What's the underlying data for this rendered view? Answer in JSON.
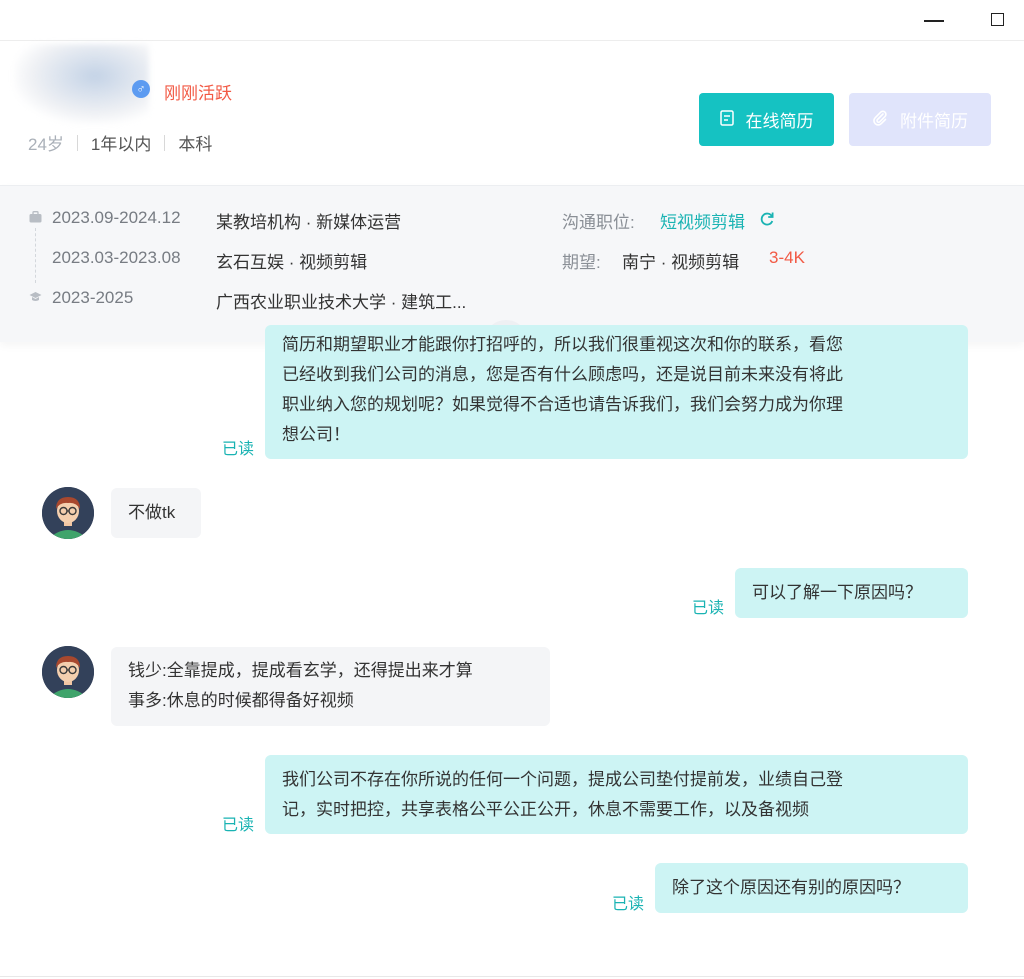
{
  "window": {
    "minimize_icon": "minimize-icon",
    "maximize_icon": "maximize-icon"
  },
  "candidate": {
    "gender_icon": "♂",
    "active_status": "刚刚活跃",
    "age": "24岁",
    "experience": "1年以内",
    "education": "本科"
  },
  "actions": {
    "online_resume": "在线简历",
    "attachment_resume": "附件简历"
  },
  "history": [
    {
      "date": "2023.09-2024.12",
      "desc": "某教培机构 · 新媒体运营",
      "icon": "briefcase-icon"
    },
    {
      "date": "2023.03-2023.08",
      "desc": "玄石互娱 · 视频剪辑",
      "icon": ""
    },
    {
      "date": "2023-2025",
      "desc": "广西农业职业技术大学 · 建筑工...",
      "icon": "graduation-cap-icon"
    }
  ],
  "job": {
    "comm_label": "沟通职位:",
    "comm_value": "短视频剪辑",
    "expect_label": "期望:",
    "expect_value": "南宁 · 视频剪辑",
    "salary": "3-4K"
  },
  "messages": [
    {
      "from": "me",
      "lines": [
        "简历和期望职业才能跟你打招呼的，所以我们很重视这次和你的联系，看您",
        "已经收到我们公司的消息，您是否有什么顾虑吗，还是说目前未来没有将此",
        "职业纳入您的规划呢？如果觉得不合适也请告诉我们，我们会努力成为你理",
        "想公司！"
      ],
      "status": "已读"
    },
    {
      "from": "them",
      "lines": [
        "不做tk"
      ]
    },
    {
      "from": "me",
      "lines": [
        "可以了解一下原因吗？"
      ],
      "status": "已读"
    },
    {
      "from": "them",
      "lines": [
        "钱少:全靠提成，提成看玄学，还得提出来才算",
        "事多:休息的时候都得备好视频"
      ]
    },
    {
      "from": "me",
      "lines": [
        "我们公司不存在你所说的任何一个问题，提成公司垫付提前发，业绩自己登",
        "记，实时把控，共享表格公平公正公开，休息不需要工作，以及备视频"
      ],
      "status": "已读"
    },
    {
      "from": "me",
      "lines": [
        "除了这个原因还有别的原因吗？"
      ],
      "status": "已读"
    }
  ],
  "colors": {
    "accent": "#15c2c2",
    "accent_text": "#1ab3b3",
    "highlight": "#f25a45",
    "my_bubble": "#cdf4f4",
    "their_bubble": "#f4f5f7"
  }
}
